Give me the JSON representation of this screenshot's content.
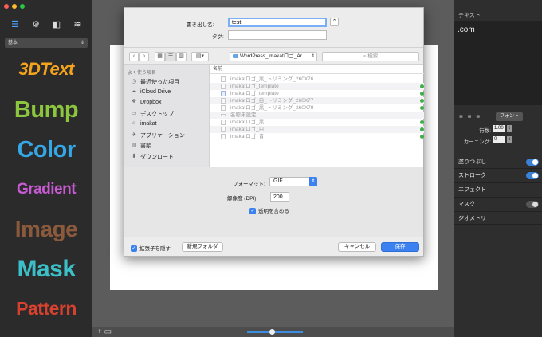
{
  "left_panel": {
    "preset": "基本",
    "styles": [
      {
        "label": "3DText",
        "color": "#f3a31e"
      },
      {
        "label": "Bump",
        "color": "#8cc63f"
      },
      {
        "label": "Color",
        "color": "#35a7e6"
      },
      {
        "label": "Gradient",
        "color": "#c85ad3"
      },
      {
        "label": "Image",
        "color": "#8b5a3c"
      },
      {
        "label": "Mask",
        "color": "#3dbfc8"
      },
      {
        "label": "Pattern",
        "color": "#d8412f"
      }
    ]
  },
  "dialog": {
    "export_label": "書き出し名:",
    "export_value": "test",
    "tags_label": "タグ:",
    "tags_value": "",
    "location": "WordPress_imakatロゴ_Ar...",
    "search_placeholder": "検索",
    "sidebar_header": "よく使う項目",
    "sidebar_items": [
      {
        "label": "最近使った項目",
        "icon": "clock-icon"
      },
      {
        "label": "iCloud Drive",
        "icon": "cloud-icon"
      },
      {
        "label": "Dropbox",
        "icon": "dropbox-icon"
      },
      {
        "label": "デスクトップ",
        "icon": "desktop-icon"
      },
      {
        "label": "imakat",
        "icon": "home-icon"
      },
      {
        "label": "アプリケーション",
        "icon": "apps-icon"
      },
      {
        "label": "書類",
        "icon": "document-icon"
      },
      {
        "label": "ダウンロード",
        "icon": "download-icon"
      }
    ],
    "column_header": "名前",
    "files": [
      "imakatロゴ_黒_トリミング_260X76",
      "imakatロゴ_template",
      "imakatロゴ_template",
      "imakatロゴ_白_トリミング_260X77",
      "imakatロゴ_黒_トリミング_260X79",
      "名称未設定",
      "imakatロゴ_黒",
      "imakatロゴ_白",
      "imakatロゴ_青"
    ],
    "format_label": "フォーマット:",
    "format_value": "GIF",
    "resolution_label": "解像度 (DPI):",
    "resolution_value": "200",
    "transparency_label": "透明を含める",
    "hide_ext_label": "拡張子を隠す",
    "new_folder": "新規フォルダ",
    "cancel": "キャンセル",
    "save": "保存"
  },
  "right_panel": {
    "header": "テキスト",
    "text_value": ".com",
    "font_button": "フォント",
    "line_label": "行数:",
    "line_value": "1.00",
    "kerning_label": "カーニング:",
    "kerning_value": "0",
    "sections": [
      {
        "label": "塗りつぶし",
        "toggle": "on"
      },
      {
        "label": "ストローク",
        "toggle": "on"
      },
      {
        "label": "エフェクト",
        "toggle": "none"
      },
      {
        "label": "マスク",
        "toggle": "off"
      },
      {
        "label": "ジオメトリ",
        "toggle": "none"
      }
    ]
  }
}
